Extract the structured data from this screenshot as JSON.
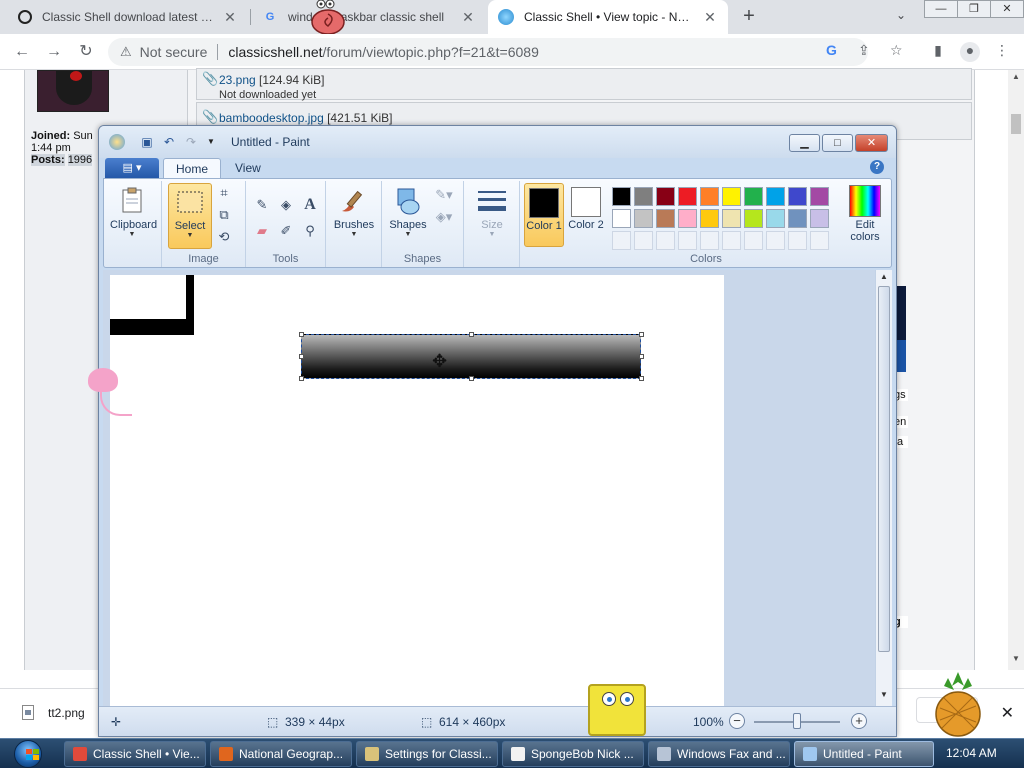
{
  "browser": {
    "tabs": [
      {
        "title": "Classic Shell download latest version",
        "icon": "qwant-icon",
        "active": false
      },
      {
        "title": "windows taskbar classic shell",
        "icon": "google-icon",
        "active": false
      },
      {
        "title": "Classic Shell • View topic - New task",
        "icon": "classic-shell-icon",
        "active": true
      }
    ],
    "new_tab": "+",
    "tab_menu": "⌄",
    "window_buttons": [
      "—",
      "❐",
      "✕"
    ],
    "address": {
      "warning": "Not secure",
      "host": "classicshell.net",
      "path": "/forum/viewtopic.php?f=21&t=6089"
    }
  },
  "forum": {
    "joined_label": "Joined:",
    "joined_value": "Sun",
    "joined_time": "1:44 pm",
    "posts_label": "Posts:",
    "posts_value": "1996",
    "attachments": [
      {
        "name": "23.png",
        "size": "[124.94 KiB]",
        "note": "Not downloaded yet"
      },
      {
        "name": "bamboodesktop.jpg",
        "size": "[421.51 KiB]",
        "note": ""
      }
    ],
    "right_snippets": [
      "gs",
      "en",
      "ta",
      "g"
    ]
  },
  "paint": {
    "title": "Untitled - Paint",
    "tabs": [
      "Home",
      "View"
    ],
    "groups": {
      "clipboard": "Clipboard",
      "image": "Image",
      "tools": "Tools",
      "shapes": "Shapes",
      "colors": "Colors"
    },
    "buttons": {
      "clipboard": "Clipboard",
      "select": "Select",
      "brushes": "Brushes",
      "shapes": "Shapes",
      "size": "Size",
      "color1": "Color 1",
      "color2": "Color 2",
      "edit_colors": "Edit colors"
    },
    "palette_row1": [
      "#000000",
      "#7f7f7f",
      "#880015",
      "#ed1c24",
      "#ff7f27",
      "#fff200",
      "#22b14c",
      "#00a2e8",
      "#3f48cc",
      "#a349a4"
    ],
    "palette_row2": [
      "#ffffff",
      "#c3c3c3",
      "#b97a57",
      "#ffaec9",
      "#ffc90e",
      "#efe4b0",
      "#b5e61d",
      "#99d9ea",
      "#7092be",
      "#c8bfe7"
    ],
    "color1": "#000000",
    "color2": "#ffffff",
    "status": {
      "selection_size": "339 × 44px",
      "image_size": "614 × 460px",
      "zoom": "100%"
    }
  },
  "downloads": {
    "file": "tt2.png",
    "close": "✕"
  },
  "taskbar": {
    "items": [
      {
        "label": "Classic Shell • Vie...",
        "color": "#e14a3b"
      },
      {
        "label": "National Geograp...",
        "color": "#e0661e"
      },
      {
        "label": "Settings for Classi...",
        "color": "#d9c27a"
      },
      {
        "label": "SpongeBob Nick ...",
        "color": "#f2f2f2"
      },
      {
        "label": "Windows Fax and ...",
        "color": "#b7c4d6"
      },
      {
        "label": "Untitled - Paint",
        "color": "#9fc7ef"
      }
    ],
    "clock": "12:04 AM"
  }
}
